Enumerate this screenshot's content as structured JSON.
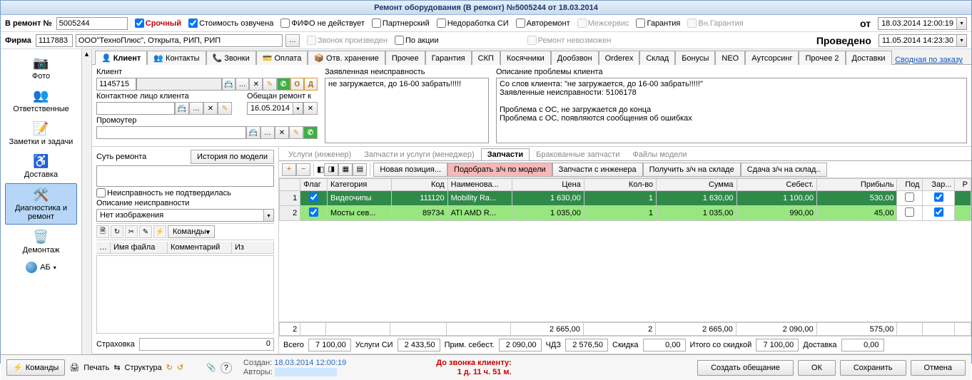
{
  "title": "Ремонт оборудования (В ремонт) №5005244 от 18.03.2014",
  "header": {
    "label_no": "В ремонт №",
    "no_value": "5005244",
    "urgent": "Срочный",
    "cost_voiced": "Стоимость озвучена",
    "fifo": "ФИФО не действует",
    "partner": "Партнерский",
    "sidef": "Недоработка СИ",
    "autorepair": "Авторемонт",
    "interservice": "Межсервис",
    "warranty": "Гарантия",
    "ext_warranty": "Вн.Гарантия",
    "from_lbl": "от",
    "from_date": "18.03.2014 12:00:19",
    "firm_lbl": "Фирма",
    "firm_code": "1117883",
    "firm_name": "ООО\"ТехноПлюс\", Открыта, РИП, РИП",
    "call_done": "Звонок произведен",
    "promo": "По акции",
    "repair_impossible": "Ремонт невозможен",
    "posted": "Проведено",
    "posted_date": "11.05.2014 14:23:30"
  },
  "sidebar": {
    "photo": "Фото",
    "responsible": "Ответственные",
    "notes": "Заметки и задачи",
    "delivery": "Доставка",
    "diagnostics": "Диагностика и ремонт",
    "dismantle": "Демонтаж",
    "ab": "АБ"
  },
  "tabs": [
    "Клиент",
    "Контакты",
    "Звонки",
    "Оплата",
    "Отв. хранение",
    "Прочее",
    "Гарантия",
    "СКП",
    "Косячники",
    "Дообзвон",
    "Orderex",
    "Склад",
    "Бонусы",
    "NEO",
    "Аутсорсинг",
    "Прочее 2",
    "Доставки"
  ],
  "summary_link": "Сводная по заказу",
  "client": {
    "lbl": "Клиент",
    "id": "1145715",
    "contact_lbl": "Контактное лицо клиента",
    "promised_lbl": "Обещан ремонт к",
    "promised_date": "16.05.2014",
    "promoter_lbl": "Промоутер",
    "fault_lbl": "Заявленная неисправность",
    "fault_text": "не загружается, до 16-00 забрать!!!!!",
    "problem_lbl": "Описание проблемы клиента",
    "problem_text": "Со слов клиента: \"не загружается, до 16-00 забрать!!!!!\"\nЗаявленные неисправности: 5106178\n\nПроблема с ОС, не загружается до конца\nПроблема с ОС, появляются сообщения об ошибках"
  },
  "essence": {
    "lbl": "Суть ремонта",
    "history_btn": "История по модели",
    "not_confirmed": "Неисправность не подтвердилась",
    "desc_lbl": "Описание неисправности",
    "no_image": "Нет изображения",
    "commands": "Команды",
    "filehdr_name": "Имя файла",
    "filehdr_comment": "Комментарий",
    "filehdr_from": "Из",
    "insurance_lbl": "Страховка",
    "insurance_val": "0"
  },
  "subtabs": [
    "Услуги (инженер)",
    "Запчасти и услуги (менеджер)",
    "Запчасти",
    "Бракованные запчасти",
    "Файлы модели"
  ],
  "partstoolbar": {
    "newpos": "Новая позиция...",
    "pickmodel": "Подобрать з/ч по модели",
    "fromeng": "Запчасти с инженера",
    "getstock": "Получить з/ч на складе",
    "tostock": "Сдача з/ч на склад.."
  },
  "partscols": [
    "",
    "Флаг",
    "Категория",
    "Код",
    "Наименова...",
    "Цена",
    "Кол-во",
    "Сумма",
    "Себест.",
    "Прибыль",
    "Под",
    "Зар...",
    "Р"
  ],
  "partsrows": [
    {
      "n": "1",
      "flag": true,
      "cat": "Видеочипы",
      "code": "111120",
      "name": "Mobility Ra...",
      "price": "1 630,00",
      "qty": "1",
      "sum": "1 630,00",
      "cost": "1 100,00",
      "profit": "530,00",
      "pod": false,
      "zar": true
    },
    {
      "n": "2",
      "flag": true,
      "cat": "Мосты сев...",
      "code": "89734",
      "name": "ATI AMD R...",
      "price": "1 035,00",
      "qty": "1",
      "sum": "1 035,00",
      "cost": "990,00",
      "profit": "45,00",
      "pod": false,
      "zar": true
    }
  ],
  "sumrow": {
    "count": "2",
    "price": "2 665,00",
    "qty": "2",
    "sum": "2 665,00",
    "cost": "2 090,00",
    "profit": "575,00"
  },
  "totals": {
    "total_lbl": "Всего",
    "total": "7 100,00",
    "servsi_lbl": "Услуги СИ",
    "servsi": "2 433,50",
    "approx_lbl": "Прим. себест.",
    "approx": "2 090,00",
    "chdz_lbl": "ЧДЗ",
    "chdz": "2 576,50",
    "disc_lbl": "Скидка",
    "disc": "0,00",
    "withdisc_lbl": "Итого со скидкой",
    "withdisc": "7 100,00",
    "delivery_lbl": "Доставка",
    "delivery": "0,00"
  },
  "footer": {
    "commands": "Команды",
    "print": "Печать",
    "structure": "Структура",
    "created_lbl": "Создан:",
    "created": "18.03.2014 12:00:19",
    "authors_lbl": "Авторы:",
    "callclient": "До звонка клиенту:",
    "calltime": "1 д. 11 ч. 51 м.",
    "promise_btn": "Создать обещание",
    "ok": "ОК",
    "save": "Сохранить",
    "cancel": "Отмена"
  }
}
